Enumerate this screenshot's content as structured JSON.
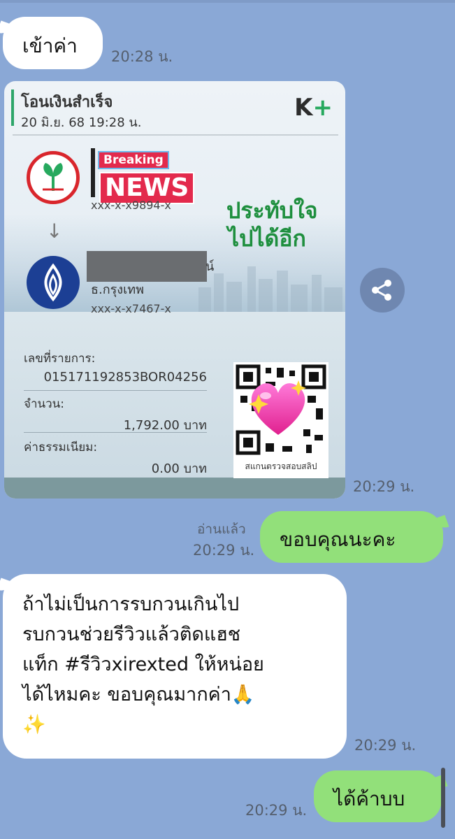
{
  "messages": {
    "m1": {
      "text": "เข้าค่า",
      "time": "20:28 น."
    },
    "slip": {
      "title": "โอนเงินสำเร็จ",
      "date": "20 มิ.ย. 68  19:28 น.",
      "brand_k": "K",
      "brand_plus": "+",
      "breaking": "Breaking",
      "news": "NEWS",
      "from_account": "xxx-x-x9894-x",
      "promo_line1": "ประทับใจ",
      "promo_line2": "ไปได้อีก",
      "to_name_fragment": "น์",
      "to_bank": "ธ.กรุงเทพ",
      "to_account": "xxx-x-x7467-x",
      "ref_label": "เลขที่รายการ:",
      "ref_value": "015171192853BOR04256",
      "amount_label": "จำนวน:",
      "amount_value": "1,792.00 บาท",
      "fee_label": "ค่าธรรมเนียม:",
      "fee_value": "0.00 บาท",
      "qr_caption": "สแกนตรวจสอบสลิป",
      "time": "20:29 น."
    },
    "m2": {
      "text": "ขอบคุณนะคะ",
      "read": "อ่านแล้ว",
      "time": "20:29 น."
    },
    "m3": {
      "line1": "ถ้าไม่เป็นการรบกวนเกินไป",
      "line2": "รบกวนช่วยรีวิวแล้วติดแฮช",
      "line3": "แท็ก #รีวิวxirexted ให้หน่อย",
      "line4": "ได้ไหมคะ ขอบคุณมากค่า🙏",
      "line5": "✨",
      "time": "20:29 น."
    },
    "m4": {
      "text": "ได้ค้าบบ",
      "time": "20:29 น."
    }
  },
  "icons": {
    "share": "share-icon",
    "heart": "sparkling-heart-icon"
  },
  "colors": {
    "background": "#8aa8d6",
    "incoming": "#ffffff",
    "outgoing": "#92e07a",
    "kbank_green": "#26a95e"
  }
}
